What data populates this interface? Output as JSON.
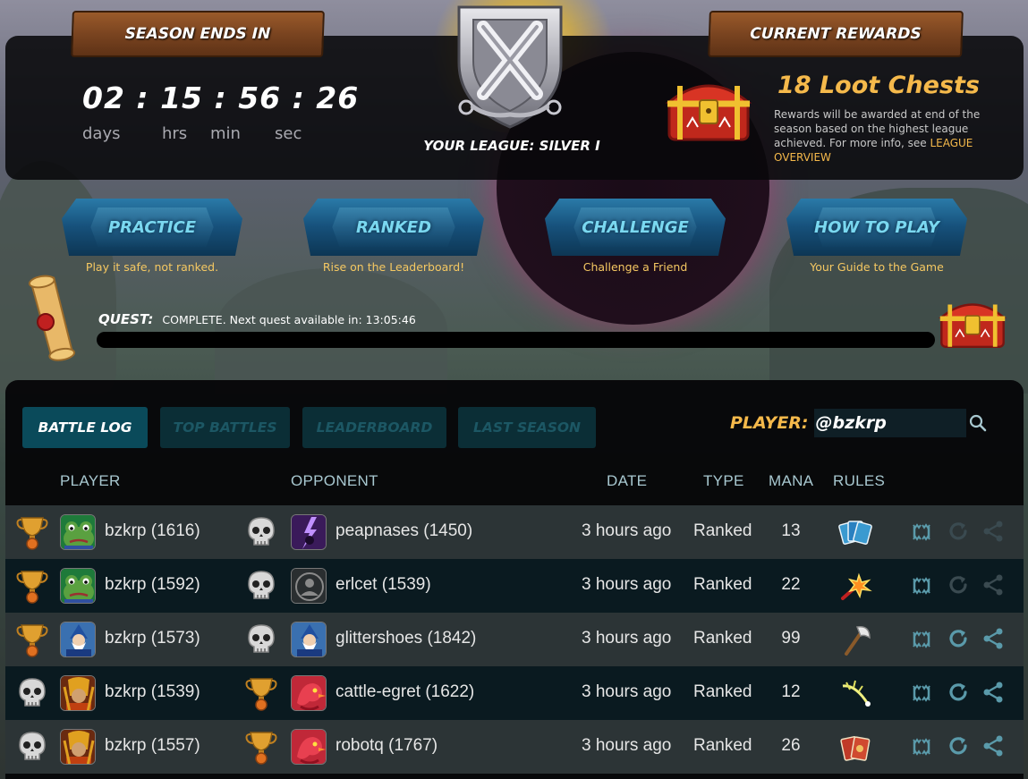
{
  "season": {
    "label": "SEASON ENDS IN",
    "countdown": "02 : 15 : 56 : 26",
    "units": [
      "days",
      "hrs",
      "min",
      "sec"
    ]
  },
  "league": {
    "label": "YOUR LEAGUE: SILVER I",
    "icon": "silver-league-emblem-icon"
  },
  "rewards": {
    "label": "CURRENT REWARDS",
    "title": "18 Loot Chests",
    "desc": "Rewards will be awarded at end of the season based on the highest league achieved. For more info, see",
    "link": "LEAGUE OVERVIEW"
  },
  "modes": [
    {
      "label": "PRACTICE",
      "sub": "Play it safe, not ranked."
    },
    {
      "label": "RANKED",
      "sub": "Rise on the Leaderboard!"
    },
    {
      "label": "CHALLENGE",
      "sub": "Challenge a Friend"
    },
    {
      "label": "HOW TO PLAY",
      "sub": "Your Guide to the Game"
    }
  ],
  "quest": {
    "label": "QUEST:",
    "text": "COMPLETE. Next quest available in: 13:05:46"
  },
  "tabs": [
    "BATTLE LOG",
    "TOP BATTLES",
    "LEADERBOARD",
    "LAST SEASON"
  ],
  "player_search": {
    "label": "PLAYER:",
    "value": "@bzkrp"
  },
  "columns": {
    "player": "PLAYER",
    "opponent": "OPPONENT",
    "date": "DATE",
    "type": "TYPE",
    "mana": "MANA",
    "rules": "RULES"
  },
  "battles": [
    {
      "result": "win",
      "player": "bzkrp (1616)",
      "player_avatar": "frog",
      "opponent": "peapnases (1450)",
      "opp_avatar": "lightning",
      "date": "3 hours ago",
      "type": "Ranked",
      "mana": "13",
      "rule_icon": "cards-blue-icon"
    },
    {
      "result": "win",
      "player": "bzkrp (1592)",
      "player_avatar": "frog",
      "opponent": "erlcet (1539)",
      "opp_avatar": "default",
      "date": "3 hours ago",
      "type": "Ranked",
      "mana": "22",
      "rule_icon": "explosion-icon"
    },
    {
      "result": "win",
      "player": "bzkrp (1573)",
      "player_avatar": "wizard",
      "opponent": "glittershoes (1842)",
      "opp_avatar": "wizard",
      "date": "3 hours ago",
      "type": "Ranked",
      "mana": "99",
      "rule_icon": "axe-icon"
    },
    {
      "result": "loss",
      "player": "bzkrp (1539)",
      "player_avatar": "warrior",
      "opponent": "cattle-egret (1622)",
      "opp_avatar": "dragon",
      "date": "3 hours ago",
      "type": "Ranked",
      "mana": "12",
      "rule_icon": "spark-icon"
    },
    {
      "result": "loss",
      "player": "bzkrp (1557)",
      "player_avatar": "warrior",
      "opponent": "robotq (1767)",
      "opp_avatar": "dragon",
      "date": "3 hours ago",
      "type": "Ranked",
      "mana": "26",
      "rule_icon": "cards-red-icon"
    }
  ],
  "colors": {
    "accent_gold": "#f5b94b",
    "tab_active": "#0a4a5a",
    "mode_text": "#7ad8f0"
  }
}
